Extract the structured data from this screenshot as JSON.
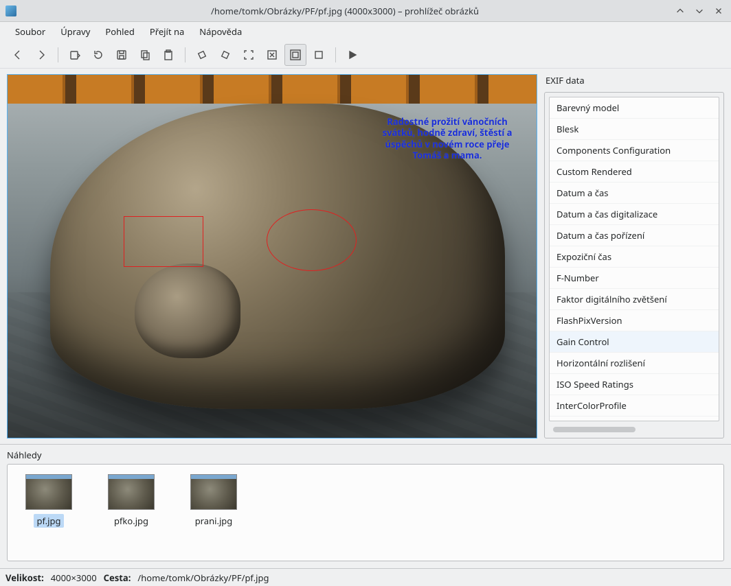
{
  "window": {
    "title": "/home/tomk/Obrázky/PF/pf.jpg (4000x3000) – prohlížeč obrázků"
  },
  "menu": {
    "file": "Soubor",
    "edit": "Úpravy",
    "view": "Pohled",
    "go": "Přejít na",
    "help": "Nápověda"
  },
  "overlay": {
    "text": "Radostné prožití vánočních svátků, hodně zdraví, štěstí a úspěchů v novém roce přeje Tomáš a mama."
  },
  "exif": {
    "title": "EXIF data",
    "items": [
      "Barevný model",
      "Blesk",
      "Components Configuration",
      "Custom Rendered",
      "Datum a čas",
      "Datum a čas digitalizace",
      "Datum a čas pořízení",
      "Expoziční čas",
      "F-Number",
      "Faktor digitálního zvětšení",
      "FlashPixVersion",
      "Gain Control",
      "Horizontální rozlišení",
      "ISO Speed Ratings",
      "InterColorProfile"
    ],
    "hover_index": 11
  },
  "thumbnails": {
    "title": "Náhledy",
    "items": [
      {
        "label": "pf.jpg",
        "selected": true
      },
      {
        "label": "pfko.jpg",
        "selected": false
      },
      {
        "label": "prani.jpg",
        "selected": false
      }
    ]
  },
  "status": {
    "size_label": "Velikost:",
    "size_value": "4000×3000",
    "path_label": "Cesta:",
    "path_value": "/home/tomk/Obrázky/PF/pf.jpg"
  }
}
